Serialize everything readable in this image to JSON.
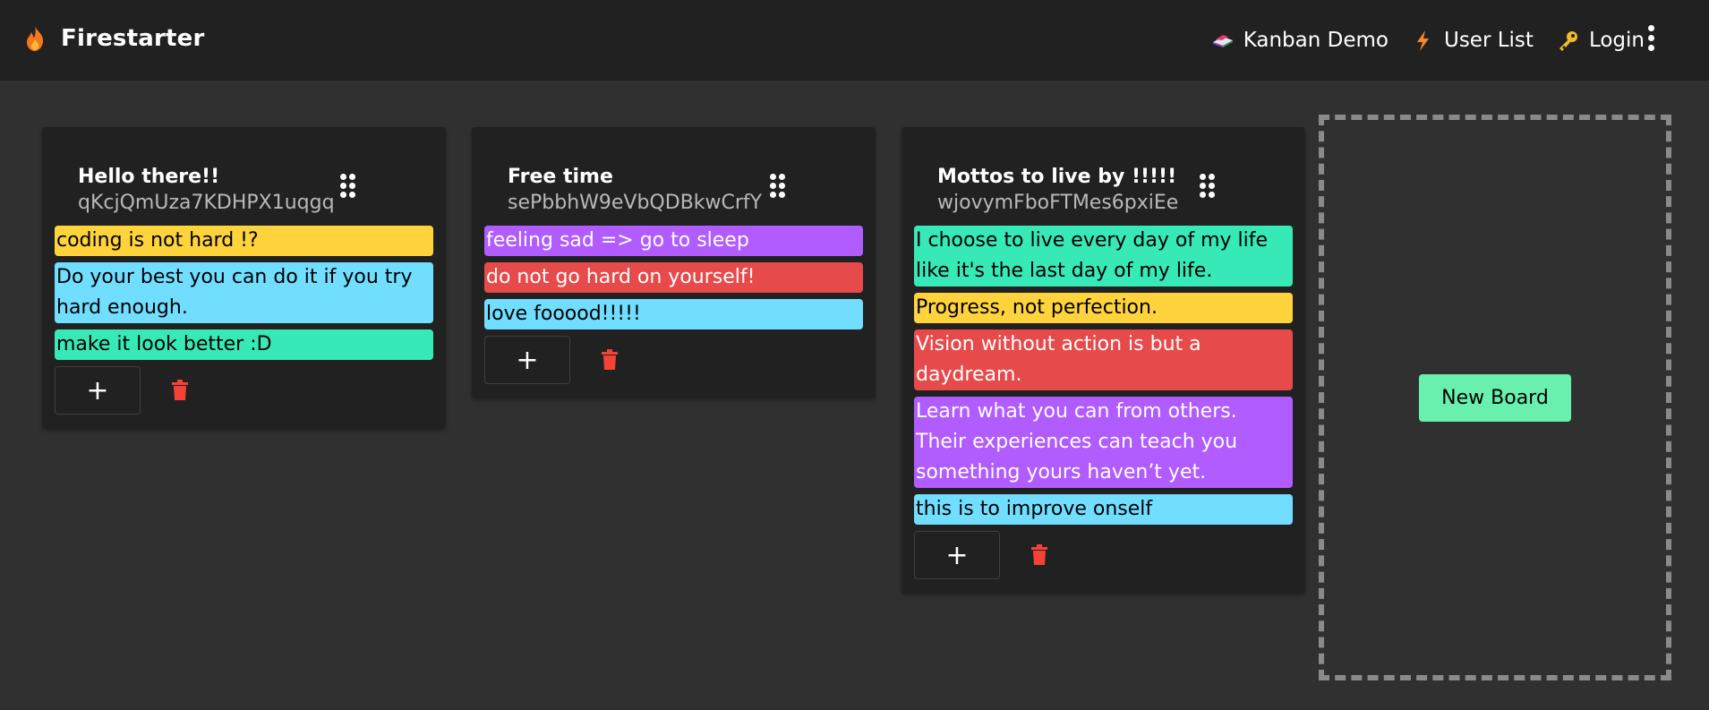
{
  "app": {
    "title": "Firestarter"
  },
  "nav": [
    {
      "label": "Kanban Demo",
      "icon": "books-icon"
    },
    {
      "label": "User List",
      "icon": "lightning-icon"
    },
    {
      "label": "Login",
      "icon": "key-icon"
    }
  ],
  "colors": {
    "yellow": "#fed33b",
    "blue": "#71deff",
    "green": "#36e9b6",
    "purple": "#b05cff",
    "red": "#e74a4a",
    "accent": "#69f0ae",
    "delete": "#f44336"
  },
  "boards": [
    {
      "title": "Hello there!!",
      "id": "qKcjQmUza7KDHPX1uqgq",
      "tasks": [
        {
          "text": "coding is not hard !?",
          "color": "yellow"
        },
        {
          "text": "Do your best you can do it if you try hard enough.",
          "color": "blue"
        },
        {
          "text": "make it look better :D",
          "color": "green"
        }
      ],
      "add_label": "+"
    },
    {
      "title": "Free time",
      "id": "sePbbhW9eVbQDBkwCrfY",
      "tasks": [
        {
          "text": "feeling sad => go to sleep",
          "color": "purple"
        },
        {
          "text": "do not go hard on yourself!",
          "color": "red"
        },
        {
          "text": "love fooood!!!!!",
          "color": "blue"
        }
      ],
      "add_label": "+"
    },
    {
      "title": "Mottos to live by !!!!!",
      "id": "wjovymFboFTMes6pxiEe",
      "tasks": [
        {
          "text": "I choose to live every day of my life like it's the last day of my life.",
          "color": "green"
        },
        {
          "text": "Progress, not perfection.",
          "color": "yellow"
        },
        {
          "text": "Vision without action is but a daydream.",
          "color": "red"
        },
        {
          "text": "Learn what you can from others. Their experiences can teach you something yours haven’t yet.",
          "color": "purple"
        },
        {
          "text": "this is to improve onself",
          "color": "blue"
        }
      ],
      "add_label": "+"
    }
  ],
  "new_board_label": "New Board"
}
